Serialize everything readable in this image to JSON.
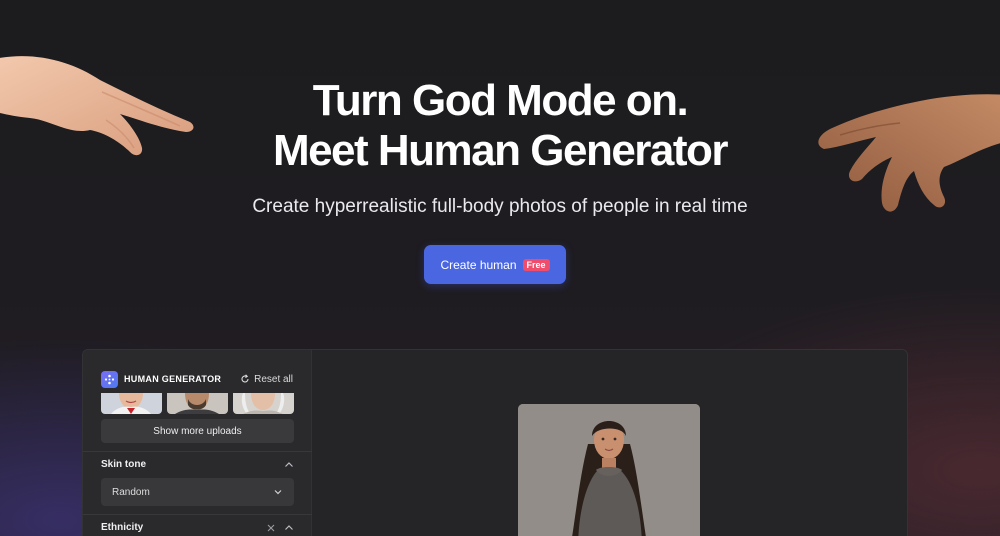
{
  "hero": {
    "title_line1": "Turn God Mode on.",
    "title_line2": "Meet Human Generator",
    "subtitle": "Create hyperrealistic full-body photos of people in real time",
    "cta_label": "Create human",
    "cta_badge": "Free"
  },
  "app": {
    "brand": "HUMAN GENERATOR",
    "reset_label": "Reset all",
    "show_more_label": "Show more uploads",
    "skin_tone": {
      "label": "Skin tone",
      "value": "Random"
    },
    "ethnicity": {
      "label": "Ethnicity"
    }
  },
  "colors": {
    "accent": "#4a67e1",
    "badge": "#f04c6b"
  }
}
